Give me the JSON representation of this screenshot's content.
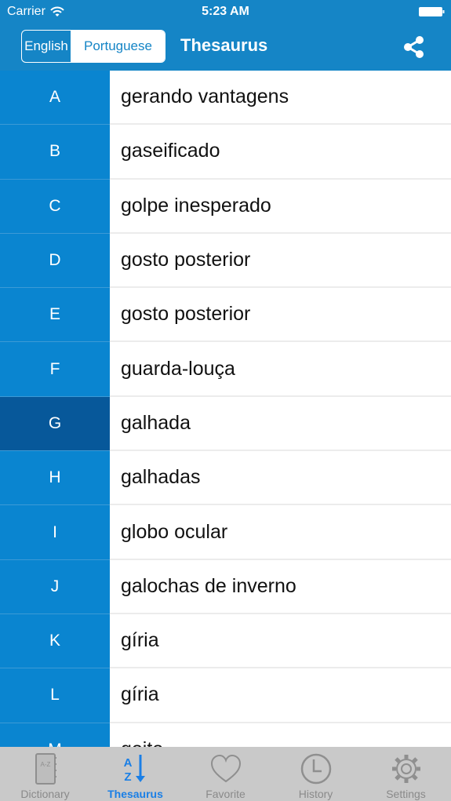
{
  "status_bar": {
    "carrier": "Carrier",
    "time": "5:23 AM"
  },
  "nav": {
    "language_options": [
      "English",
      "Portuguese"
    ],
    "selected_language": "Portuguese",
    "title": "Thesaurus",
    "share_icon": "share-icon"
  },
  "list": {
    "selected_index": 6,
    "rows": [
      {
        "letter": "A",
        "word": "gerando vantagens"
      },
      {
        "letter": "B",
        "word": "gaseificado"
      },
      {
        "letter": "C",
        "word": "golpe inesperado"
      },
      {
        "letter": "D",
        "word": "gosto posterior"
      },
      {
        "letter": "E",
        "word": "gosto posterior"
      },
      {
        "letter": "F",
        "word": "guarda-louça"
      },
      {
        "letter": "G",
        "word": "galhada"
      },
      {
        "letter": "H",
        "word": "galhadas"
      },
      {
        "letter": "I",
        "word": "globo ocular"
      },
      {
        "letter": "J",
        "word": "galochas de inverno"
      },
      {
        "letter": "K",
        "word": "gíria"
      },
      {
        "letter": "L",
        "word": "gíria"
      },
      {
        "letter": "M",
        "word": "goito"
      }
    ]
  },
  "tabbar": {
    "active": "Thesaurus",
    "tabs": [
      {
        "label": "Dictionary",
        "icon": "book-icon"
      },
      {
        "label": "Thesaurus",
        "icon": "az-sort-icon"
      },
      {
        "label": "Favorite",
        "icon": "heart-icon"
      },
      {
        "label": "History",
        "icon": "clock-icon"
      },
      {
        "label": "Settings",
        "icon": "gear-icon"
      }
    ]
  },
  "colors": {
    "header": "#1585c6",
    "letter_column": "#0a85d0",
    "letter_selected": "#07589a",
    "tab_active": "#1a7fe6",
    "tabbar_bg": "#c9c9c9"
  }
}
